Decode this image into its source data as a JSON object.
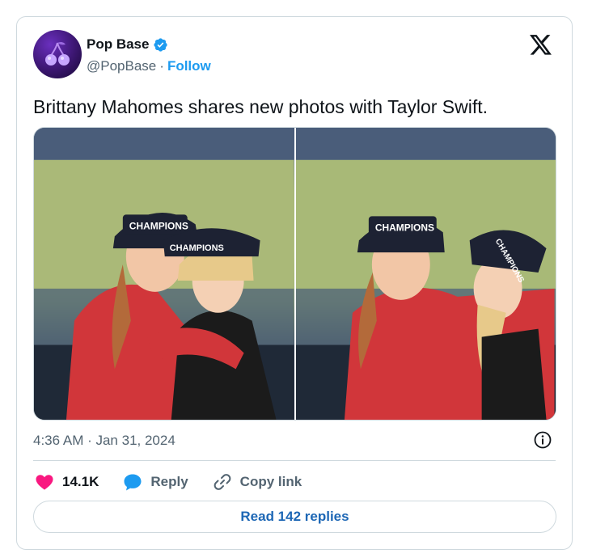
{
  "author": {
    "name": "Pop Base",
    "handle": "@PopBase",
    "separator": "·",
    "follow_label": "Follow"
  },
  "tweet": {
    "text": "Brittany Mahomes shares new photos with Taylor Swift.",
    "timestamp": "4:36 AM · Jan 31, 2024"
  },
  "media": {
    "photos": [
      {
        "cap_text_left": "CHAMPIONS",
        "cap_text_right": "CHAMPIONS"
      },
      {
        "cap_text_left": "CHAMPIONS",
        "cap_text_right": "CHAMPIONS"
      }
    ]
  },
  "actions": {
    "like_count": "14.1K",
    "reply_label": "Reply",
    "copy_link_label": "Copy link"
  },
  "read_replies_label": "Read 142 replies",
  "icons": {
    "avatar": "cherry-logo-icon",
    "verified": "verified-badge-icon",
    "platform": "x-logo-icon",
    "info": "info-icon",
    "like": "heart-icon",
    "reply": "speech-bubble-icon",
    "copy": "link-icon"
  },
  "colors": {
    "like": "#f91880",
    "reply": "#1d9bf0",
    "link": "#1d67b5",
    "verified": "#1d9bf0",
    "muted": "#536471"
  }
}
